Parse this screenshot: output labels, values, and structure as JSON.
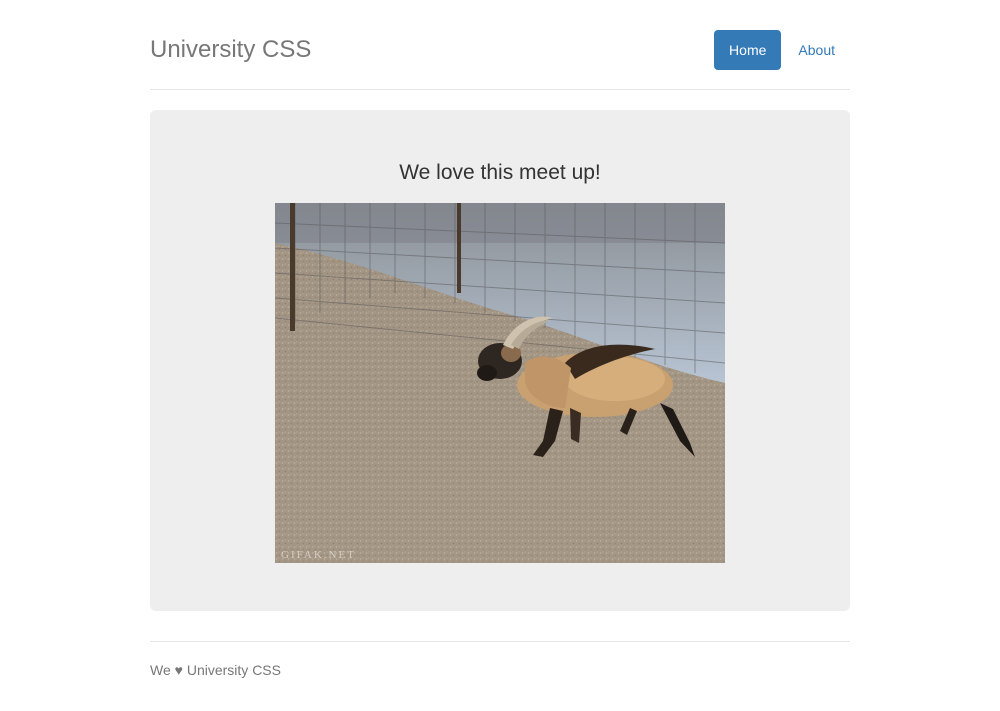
{
  "header": {
    "brand": "University CSS",
    "nav": [
      {
        "label": "Home",
        "active": true
      },
      {
        "label": "About",
        "active": false
      }
    ]
  },
  "jumbotron": {
    "title": "We love this meet up!",
    "image": {
      "subject": "goat running in a fenced dirt pen",
      "watermark": "GIFAK.NET"
    }
  },
  "footer": {
    "text_prefix": "We",
    "heart": "♥",
    "text_suffix": "University CSS"
  },
  "colors": {
    "accent": "#337ab7",
    "jumbotron_bg": "#eeeeee",
    "muted_text": "#777777"
  }
}
